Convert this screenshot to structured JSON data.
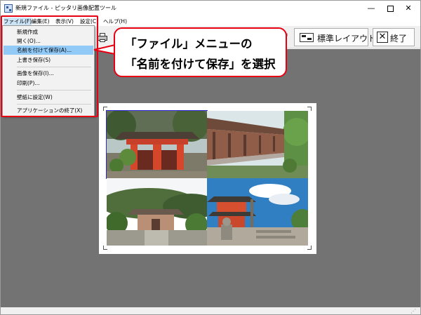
{
  "window": {
    "title": "新規ファイル - ピッタリ画像配置ツール",
    "minimize_glyph": "—",
    "close_glyph": "✕"
  },
  "menubar": {
    "items": [
      {
        "label": "ファイル(F)"
      },
      {
        "label": "編集(E)"
      },
      {
        "label": "表示(V)"
      },
      {
        "label": "設定(C"
      },
      {
        "label": "ヘルプ(H)"
      }
    ]
  },
  "toolbar": {
    "arrow_glyph": "◂",
    "layout_label": "標準レイアウト",
    "exit_label": "終了",
    "exit_glyph": "✕"
  },
  "file_menu": {
    "items": [
      {
        "label": "新規作成"
      },
      {
        "label": "開く(O)..."
      },
      {
        "label": "名前を付けて保存(A)..."
      },
      {
        "label": "上書き保存(S)"
      },
      {
        "label": "画像を保存(I)..."
      },
      {
        "label": "印刷(P)..."
      },
      {
        "label": "壁紙に設定(W)"
      },
      {
        "label": "アプリケーションの終了(X)"
      }
    ],
    "selected_index": 2
  },
  "callout": {
    "line1": "「ファイル」メニューの",
    "line2": "「名前を付けて保存」を選択"
  },
  "canvas": {
    "photos": [
      {
        "name": "vermilion-gate-photo"
      },
      {
        "name": "temple-corridor-photo"
      },
      {
        "name": "hillside-temple-photo"
      },
      {
        "name": "pagoda-temple-photo"
      }
    ]
  },
  "colors": {
    "highlight_red": "#e60012",
    "selected_item": "#91c9f7",
    "workspace_gray": "#737373"
  },
  "statusbar": {
    "grip_glyph": "⋰"
  }
}
